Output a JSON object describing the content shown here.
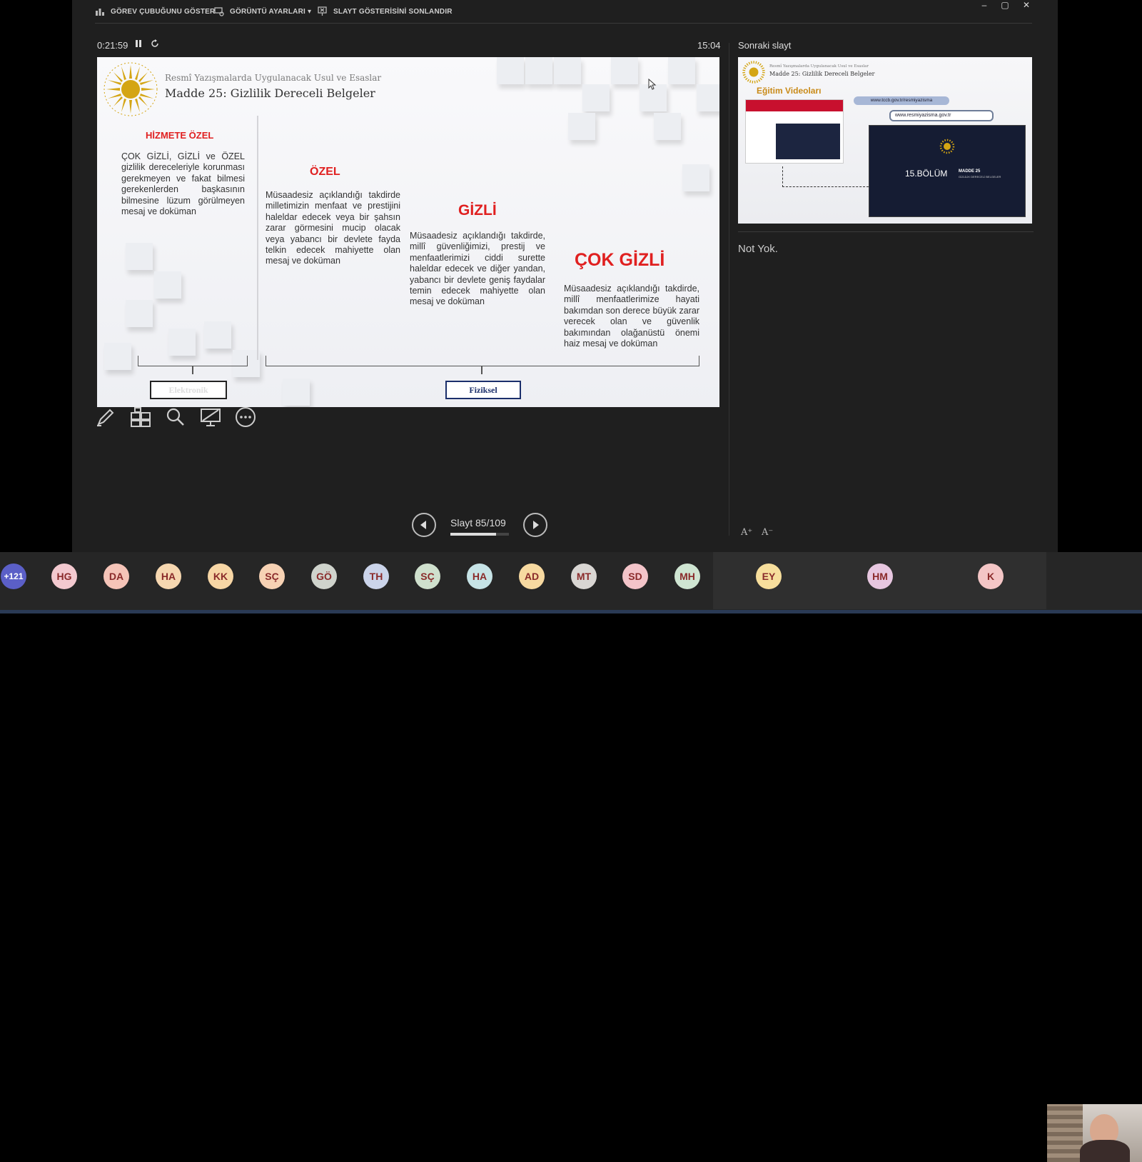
{
  "toolbar": {
    "show_taskbar": "GÖREV ÇUBUĞUNU GÖSTER",
    "display_settings": "GÖRÜNTÜ AYARLARI ▾",
    "end_show": "SLAYT GÖSTERİSİNİ SONLANDIR",
    "window_controls": [
      "–",
      "▢",
      "✕"
    ]
  },
  "timer": {
    "elapsed": "0:21:59",
    "pause_icon": "pause-icon",
    "restart_icon": "restart-icon"
  },
  "clock": "15:04",
  "slide": {
    "subtitle": "Resmî Yazışmalarda Uygulanacak Usul ve Esaslar",
    "title": "Madde 25: Gizlilik Dereceli Belgeler",
    "sections": [
      {
        "heading": "HİZMETE ÖZEL",
        "text": "ÇOK GİZLİ, GİZLİ ve ÖZEL gizlilik dereceleriyle korunması gerekmeyen ve fakat bilmesi gerekenlerden başkasının bilmesine lüzum görülmeyen mesaj ve doküman"
      },
      {
        "heading": "ÖZEL",
        "text": "Müsaadesiz açıklandığı takdirde milletimizin menfaat ve prestijini haleldar edecek veya bir şahsın zarar görmesini mucip olacak veya yabancı bir devlete fayda telkin edecek mahiyette olan mesaj ve doküman"
      },
      {
        "heading": "GİZLİ",
        "text": "Müsaadesiz açıklandığı takdirde, millî güvenliğimizi, prestij ve menfaatlerimizi ciddi surette haleldar edecek ve diğer yandan, yabancı bir devlete geniş faydalar temin edecek mahiyette olan mesaj ve doküman"
      },
      {
        "heading": "ÇOK GİZLİ",
        "text": "Müsaadesiz açıklandığı takdirde, millî menfaatlerimize hayati bakımdan son derece büyük zarar verecek olan ve güvenlik bakımından olağanüstü önemi haiz mesaj ve doküman"
      }
    ],
    "label_electronic": "Elektronik",
    "label_physical": "Fiziksel"
  },
  "tools": [
    "pen-icon",
    "slides-grid-icon",
    "zoom-icon",
    "screen-icon",
    "more-icon"
  ],
  "navigation": {
    "counter": "Slayt 85/109",
    "progress": 0.78
  },
  "next_slide": {
    "label": "Sonraki slayt",
    "subtitle": "Resmî Yazışmalarda Uygulanacak Usul ve Esaslar",
    "title": "Madde 25: Gizlilik Dereceli Belgeler",
    "heading": "Eğitim Videoları",
    "url1": "www.tccb.gov.tr/resmiyazisma",
    "url2": "www.resmiyazisma.gov.tr",
    "video_part": "15.BÖLÜM",
    "video_title": "MADDE 25",
    "video_subtitle": "GİZLİLİK DERECELİ BELGELER"
  },
  "notes": "Not Yok.",
  "font_controls": [
    "A⁺",
    "A⁻"
  ],
  "participants": {
    "overflow": "+121",
    "list": [
      {
        "initials": "HG",
        "color": "#f3c9cf"
      },
      {
        "initials": "DA",
        "color": "#f5c4b8"
      },
      {
        "initials": "HA",
        "color": "#f6d7b0"
      },
      {
        "initials": "KK",
        "color": "#f7d6a5"
      },
      {
        "initials": "SÇ",
        "color": "#f7d2b4"
      },
      {
        "initials": "GÖ",
        "color": "#cfd3cc"
      },
      {
        "initials": "TH",
        "color": "#cbd4ea"
      },
      {
        "initials": "SÇ",
        "color": "#cfe0cd"
      },
      {
        "initials": "HA",
        "color": "#c6e3e6"
      },
      {
        "initials": "AD",
        "color": "#f7d9a0"
      },
      {
        "initials": "MT",
        "color": "#d9d6d3"
      },
      {
        "initials": "SD",
        "color": "#f3c4c9"
      },
      {
        "initials": "MH",
        "color": "#cfe5d2"
      },
      {
        "initials": "EY",
        "color": "#f7de9c"
      },
      {
        "initials": "HM",
        "color": "#e7c7e0"
      },
      {
        "initials": "K",
        "color": "#f4c6c6"
      }
    ]
  },
  "colors": {
    "heading_red": "#e02020",
    "avatar_overflow": "#5b5fc7",
    "background": "#1f1f1f"
  }
}
